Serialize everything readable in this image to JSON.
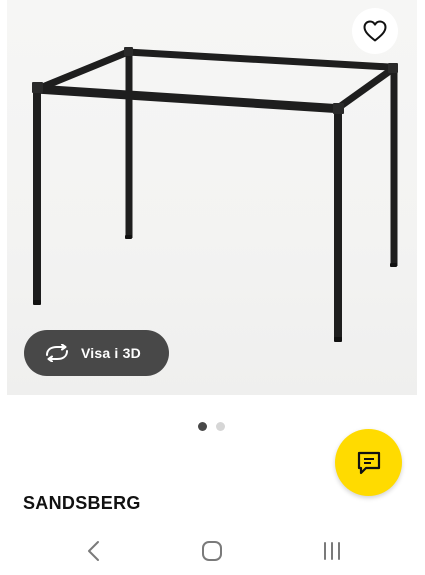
{
  "product": {
    "name": "SANDSBERG"
  },
  "view3d": {
    "label": "Visa i 3D",
    "icon": "rotate-3d-icon"
  },
  "favorite": {
    "icon": "heart-icon"
  },
  "chat": {
    "icon": "chat-bubble-icon"
  },
  "carousel": {
    "total": 2,
    "active_index": 0
  },
  "nav": {
    "items": [
      "back-icon",
      "home-icon",
      "recents-icon"
    ]
  },
  "colors": {
    "accent_yellow": "#ffdb00",
    "pill_background": "#484848",
    "dot_active": "#484848",
    "dot_inactive": "#d6d6d6",
    "frame": "#1e1e1e"
  }
}
